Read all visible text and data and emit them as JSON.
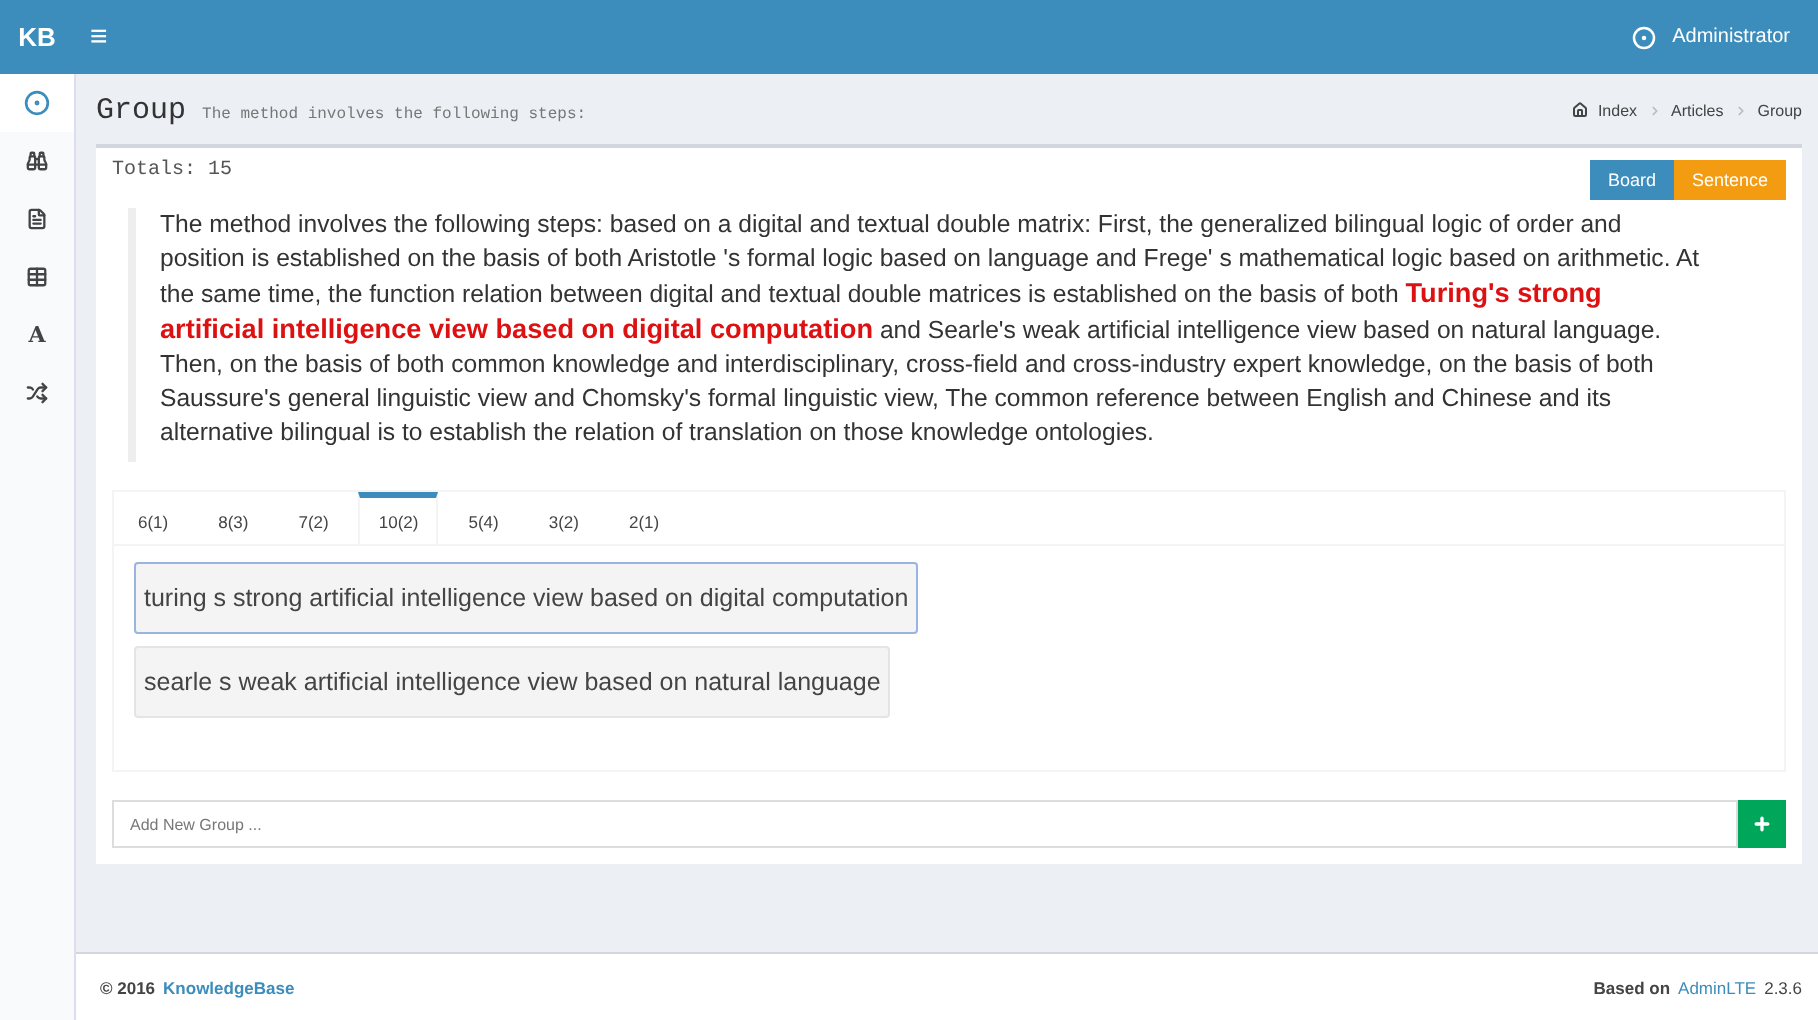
{
  "header": {
    "logo": "KB",
    "menu_glyph": "≡",
    "user": "Administrator"
  },
  "sidebar": {
    "items": [
      {
        "kind": "user",
        "selected": true
      },
      {
        "kind": "binoculars",
        "selected": false
      },
      {
        "kind": "file",
        "selected": false
      },
      {
        "kind": "table",
        "selected": false
      },
      {
        "kind": "glyph",
        "glyph": "A",
        "selected": false
      },
      {
        "kind": "shuffle",
        "selected": false
      }
    ]
  },
  "page": {
    "title": "Group",
    "subtitle": "The method involves the following steps:",
    "breadcrumb": [
      "Index",
      "Articles",
      "Group"
    ]
  },
  "box": {
    "totals": "Totals: 15",
    "buttons": [
      {
        "label": "Board",
        "kind": "primary"
      },
      {
        "label": "Sentence",
        "kind": "warning"
      }
    ],
    "paragraph": "The method involves the following steps: based on a digital and textual double matrix: First, the generalized bilingual logic of order and position is established on the basis of both Aristotle 's formal logic based on language and Frege' s mathematical logic based on arithmetic. At the same time, the function relation between digital and textual double matrices is established on the basis of both **Turing's strong artificial intelligence view based on digital computation** and Searle's weak artificial intelligence view based on natural language. Then, on the basis of both common knowledge and interdisciplinary, cross-field and cross-industry expert knowledge, on the basis of both Saussure's general linguistic view and Chomsky's formal linguistic view, The common reference between English and Chinese and its alternative bilingual is to establish the relation of translation on those knowledge ontologies.",
    "tabs": [
      {
        "label": "6(1)",
        "selected": false
      },
      {
        "label": "8(3)",
        "selected": false
      },
      {
        "label": "7(2)",
        "selected": false
      },
      {
        "label": "10(2)",
        "selected": true
      },
      {
        "label": "5(4)",
        "selected": false
      },
      {
        "label": "3(2)",
        "selected": false
      },
      {
        "label": "2(1)",
        "selected": false
      }
    ],
    "phrases": [
      {
        "text": "turing s strong artificial intelligence view based on digital computation",
        "selected": true
      },
      {
        "text": "searle s weak artificial intelligence view based on natural language",
        "selected": false
      }
    ],
    "new_group": {
      "placeholder": "Add New Group ..."
    }
  },
  "footer": {
    "copyright": "© 2016",
    "brand": "KnowledgeBase",
    "based_on": "Based on",
    "framework": "AdminLTE",
    "version": "2.3.6"
  }
}
